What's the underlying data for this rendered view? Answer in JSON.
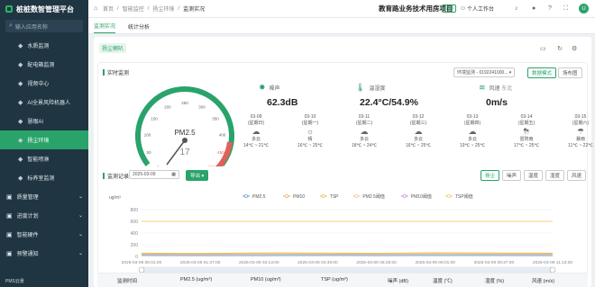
{
  "app": {
    "title": "桩桩数智管理平台",
    "footer": "PMS云景"
  },
  "sidebar": {
    "search_placeholder": "输入应用名称",
    "items": [
      {
        "label": "水质监测",
        "icon": "water-icon"
      },
      {
        "label": "配电箱监测",
        "icon": "power-box-icon"
      },
      {
        "label": "视频中心",
        "icon": "video-icon"
      },
      {
        "label": "AI全景风险机器人",
        "icon": "robot-icon"
      },
      {
        "label": "慧眼AI",
        "icon": "eye-icon"
      },
      {
        "label": "扬尘环境",
        "icon": "dust-icon",
        "active": true
      },
      {
        "label": "智能喷淋",
        "icon": "sprinkler-icon"
      },
      {
        "label": "标养室监测",
        "icon": "lab-icon"
      }
    ],
    "groups": [
      {
        "label": "质量管理",
        "icon": "quality-icon"
      },
      {
        "label": "进度计划",
        "icon": "schedule-icon"
      },
      {
        "label": "智能硬件",
        "icon": "hardware-icon"
      },
      {
        "label": "预警通知",
        "icon": "alert-icon"
      }
    ]
  },
  "topbar": {
    "breadcrumb": [
      "首页",
      "智能监控",
      "扬尘环境",
      "监测实况"
    ],
    "project": "教育路业务技术用房项目",
    "project_tag": "切换",
    "workbench": "个人工作台"
  },
  "tabs": [
    "监测实况",
    "统计分析"
  ],
  "main": {
    "device_chip": "扬尘喇叭",
    "realtime": {
      "title": "实时监测",
      "gauge_label": "PM2.5",
      "gauge_value": "17",
      "gauge_ticks": [
        "0",
        "50",
        "100",
        "150",
        "200",
        "250",
        "300",
        "350",
        "400",
        "450",
        "500"
      ],
      "metrics": [
        {
          "label": "噪声",
          "value": "62.3dB",
          "icon": "noise-icon"
        },
        {
          "label": "温湿度",
          "value": "22.4°C/54.9%",
          "icon": "thermometer-icon"
        },
        {
          "label": "风速",
          "sub": "东北",
          "value": "0m/s",
          "icon": "wind-icon"
        }
      ],
      "device_select": "环境监测 - 0192241000...",
      "mode_buttons": [
        "数据模式",
        "场布图"
      ],
      "forecast": [
        {
          "date": "03-09",
          "weekday": "(星期日)",
          "weather": "多云",
          "temp": "14℃ ~ 21℃",
          "icon": "cloudy-icon"
        },
        {
          "date": "03-10",
          "weekday": "(星期一)",
          "weather": "晴",
          "temp": "16℃ ~ 25℃",
          "icon": "sunny-icon"
        },
        {
          "date": "03-11",
          "weekday": "(星期二)",
          "weather": "多云",
          "temp": "18℃ ~ 24℃",
          "icon": "cloudy-icon"
        },
        {
          "date": "03-12",
          "weekday": "(星期三)",
          "weather": "多云",
          "temp": "16℃ ~ 25℃",
          "icon": "cloudy-icon"
        },
        {
          "date": "03-13",
          "weekday": "(星期四)",
          "weather": "多云",
          "temp": "19℃ ~ 25℃",
          "icon": "cloudy-icon"
        },
        {
          "date": "03-14",
          "weekday": "(星期五)",
          "weather": "雷阵雨",
          "temp": "17℃ ~ 25℃",
          "icon": "thunder-icon"
        },
        {
          "date": "03-15",
          "weekday": "(星期六)",
          "weather": "暴雨",
          "temp": "11℃ ~ 22℃",
          "icon": "rain-icon"
        }
      ]
    },
    "records": {
      "title": "监测记录",
      "date": "2025-03-09",
      "export_label": "导出",
      "filters": [
        "扬尘",
        "噪声",
        "温度",
        "湿度",
        "风速"
      ],
      "active_filter": "扬尘"
    },
    "table_headers": [
      "监测时间",
      "PM2.5 (ug/m³)",
      "PM10 (ug/m³)",
      "TSP (ug/m³)",
      "噪声 (dB)",
      "温度 (℃)",
      "湿度 (%)",
      "风速 (m/s)"
    ]
  },
  "chart_data": {
    "type": "line",
    "ylabel": "ug/m³",
    "ylim": [
      0,
      800
    ],
    "yticks": [
      "800",
      "600",
      "400",
      "200",
      "0"
    ],
    "x": [
      "2025-03-09 00:01:00",
      "2025-03-09 01:37:00",
      "2025-03-09 03:13:00",
      "2025-03-09 04:49:00",
      "2025-03-09 06:25:00",
      "2025-03-09 08:01:00",
      "2025-03-09 09:37:00",
      "2025-03-09 11:13:00"
    ],
    "series": [
      {
        "name": "PM2.5",
        "color": "#6fa8dc",
        "values": [
          18,
          17,
          16,
          18,
          17,
          19,
          18,
          17
        ]
      },
      {
        "name": "PM10",
        "color": "#f6b26b",
        "values": [
          40,
          38,
          42,
          41,
          39,
          44,
          42,
          40
        ]
      },
      {
        "name": "TSP",
        "color": "#e6c36b",
        "values": [
          55,
          52,
          58,
          56,
          54,
          60,
          57,
          55
        ]
      },
      {
        "name": "PM2.5阈值",
        "color": "#f2cf92",
        "values": [
          600,
          600,
          600,
          600,
          600,
          600,
          600,
          600
        ]
      },
      {
        "name": "PM10阈值",
        "color": "#c9a0dc",
        "values": [
          600,
          600,
          600,
          600,
          600,
          600,
          600,
          600
        ]
      },
      {
        "name": "TSP阈值",
        "color": "#f4d07a",
        "values": [
          600,
          600,
          600,
          600,
          600,
          600,
          600,
          600
        ]
      }
    ],
    "grid": true,
    "legend": "top"
  }
}
